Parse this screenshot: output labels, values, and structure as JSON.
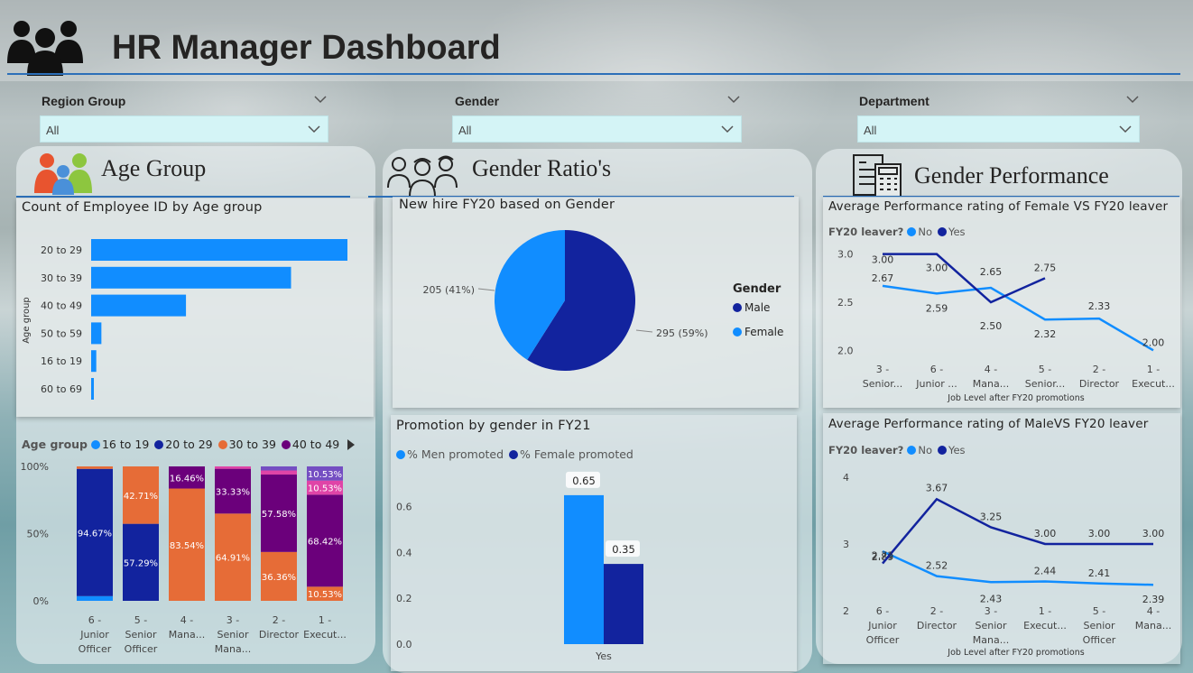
{
  "header": {
    "title": "HR Manager Dashboard",
    "icon": "people-group-icon"
  },
  "slicers": [
    {
      "label": "Region Group",
      "value": "All"
    },
    {
      "label": "Gender",
      "value": "All"
    },
    {
      "label": "Department",
      "value": "All"
    }
  ],
  "sections": {
    "age": {
      "title": "Age Group",
      "icon": "family-icon"
    },
    "gender": {
      "title": "Gender Ratio's",
      "icon": "workers-icon"
    },
    "performance": {
      "title": "Gender Performance",
      "icon": "document-calculator-icon"
    }
  },
  "colors": {
    "dark_blue": "#12239e",
    "light_blue": "#118dff",
    "orange": "#e66c37",
    "purple": "#6b007b",
    "pink": "#e044a7",
    "accent": "#2c6fb8"
  },
  "chart_data": [
    {
      "id": "age_bar",
      "type": "bar",
      "orientation": "horizontal",
      "title": "Count of Employee ID by Age group",
      "ylabel": "Age group",
      "categories": [
        "20 to 29",
        "30 to 39",
        "40 to 49",
        "50 to 59",
        "16 to 19",
        "60 to 69"
      ],
      "values": [
        100,
        78,
        37,
        4,
        2,
        1
      ]
    },
    {
      "id": "age_stacked",
      "type": "bar",
      "stacked": "100%",
      "legend_title": "Age group",
      "legend": [
        {
          "name": "16 to 19",
          "color": "#118dff"
        },
        {
          "name": "20 to 29",
          "color": "#12239e"
        },
        {
          "name": "30 to 39",
          "color": "#e66c37"
        },
        {
          "name": "40 to 49",
          "color": "#6b007b"
        }
      ],
      "yticks": [
        "100%",
        "50%",
        "0%"
      ],
      "categories": [
        [
          "6 -",
          "Junior",
          "Officer"
        ],
        [
          "5 -",
          "Senior",
          "Officer"
        ],
        [
          "4 -",
          "Mana..."
        ],
        [
          "3 -",
          "Senior",
          "Mana..."
        ],
        [
          "2 -",
          "Director"
        ],
        [
          "1 -",
          "Execut..."
        ]
      ],
      "stacks": [
        [
          {
            "v": 3.5,
            "c": "#118dff"
          },
          {
            "v": 94.67,
            "c": "#12239e",
            "label": "94.67%"
          },
          {
            "v": 1.83,
            "c": "#e66c37"
          }
        ],
        [
          {
            "v": 57.29,
            "c": "#12239e",
            "label": "57.29%"
          },
          {
            "v": 42.71,
            "c": "#e66c37",
            "label": "42.71%"
          }
        ],
        [
          {
            "v": 83.54,
            "c": "#e66c37",
            "label": "83.54%"
          },
          {
            "v": 16.46,
            "c": "#6b007b",
            "label": "16.46%"
          }
        ],
        [
          {
            "v": 64.91,
            "c": "#e66c37",
            "label": "64.91%"
          },
          {
            "v": 33.33,
            "c": "#6b007b",
            "label": "33.33%"
          },
          {
            "v": 1.76,
            "c": "#e044a7"
          }
        ],
        [
          {
            "v": 36.36,
            "c": "#e66c37",
            "label": "36.36%"
          },
          {
            "v": 57.58,
            "c": "#6b007b",
            "label": "57.58%"
          },
          {
            "v": 3.03,
            "c": "#e044a7"
          },
          {
            "v": 3.03,
            "c": "#744ec2"
          }
        ],
        [
          {
            "v": 10.53,
            "c": "#e66c37",
            "label": "10.53%"
          },
          {
            "v": 68.42,
            "c": "#6b007b",
            "label": "68.42%"
          },
          {
            "v": 10.53,
            "c": "#e044a7",
            "label": "10.53%"
          },
          {
            "v": 10.53,
            "c": "#744ec2",
            "label": "10.53%"
          }
        ]
      ]
    },
    {
      "id": "gender_pie",
      "type": "pie",
      "title": "New hire FY20 based on Gender",
      "legend_title": "Gender",
      "slices": [
        {
          "name": "Male",
          "value": 295,
          "label": "295 (59%)",
          "color": "#12239e"
        },
        {
          "name": "Female",
          "value": 205,
          "label": "205 (41%)",
          "color": "#118dff"
        }
      ]
    },
    {
      "id": "promotion",
      "type": "bar",
      "title": "Promotion by gender in FY21",
      "series": [
        {
          "name": "% Men promoted",
          "values": [
            0.65
          ],
          "color": "#118dff"
        },
        {
          "name": "% Female promoted",
          "values": [
            0.35
          ],
          "color": "#12239e"
        }
      ],
      "categories": [
        "Yes"
      ],
      "yticks": [
        "0.6",
        "0.4",
        "0.2",
        "0.0"
      ],
      "ylim": [
        0,
        0.7
      ]
    },
    {
      "id": "female_perf",
      "type": "line",
      "title": "Average Performance rating of Female VS FY20 leaver",
      "legend_title": "FY20 leaver?",
      "xlabel": "Job Level after FY20 promotions",
      "categories": [
        [
          "3 -",
          "Senior..."
        ],
        [
          "6 -",
          "Junior ..."
        ],
        [
          "4 -",
          "Mana..."
        ],
        [
          "5 -",
          "Senior..."
        ],
        [
          "2 -",
          "Director"
        ],
        [
          "1 -",
          "Execut..."
        ]
      ],
      "yticks": [
        "3.0",
        "2.5",
        "2.0"
      ],
      "ylim": [
        1.9,
        3.1
      ],
      "series": [
        {
          "name": "No",
          "color": "#118dff",
          "values": [
            2.67,
            2.59,
            2.65,
            2.32,
            2.33,
            2.0
          ],
          "labels": [
            "2.67",
            "2.59",
            "2.65",
            "2.32",
            "2.33",
            "2.00"
          ]
        },
        {
          "name": "Yes",
          "color": "#12239e",
          "values": [
            3.0,
            3.0,
            2.5,
            2.75,
            null,
            null
          ],
          "labels": [
            "3.00",
            "3.00",
            "2.50",
            "2.75",
            "",
            ""
          ]
        }
      ]
    },
    {
      "id": "male_perf",
      "type": "line",
      "title": "Average Performance rating of MaleVS FY20 leaver",
      "legend_title": "FY20 leaver?",
      "xlabel": "Job Level after FY20 promotions",
      "categories": [
        [
          "6 -",
          "Junior",
          "Officer"
        ],
        [
          "2 -",
          "Director"
        ],
        [
          "3 -",
          "Senior",
          "Mana..."
        ],
        [
          "1 -",
          "Execut..."
        ],
        [
          "5 -",
          "Senior",
          "Officer"
        ],
        [
          "4 -",
          "Mana..."
        ]
      ],
      "yticks": [
        "4",
        "3",
        "2"
      ],
      "ylim": [
        1.8,
        4.2
      ],
      "series": [
        {
          "name": "No",
          "color": "#118dff",
          "values": [
            2.89,
            2.52,
            2.43,
            2.44,
            2.41,
            2.39
          ],
          "labels": [
            "2.89",
            "2.52",
            "2.43",
            "2.44",
            "2.41",
            "2.39"
          ]
        },
        {
          "name": "Yes",
          "color": "#12239e",
          "values": [
            2.71,
            3.67,
            3.25,
            3.0,
            3.0,
            3.0
          ],
          "labels": [
            "2.71",
            "3.67",
            "3.25",
            "3.00",
            "3.00",
            "3.00"
          ]
        }
      ]
    }
  ]
}
